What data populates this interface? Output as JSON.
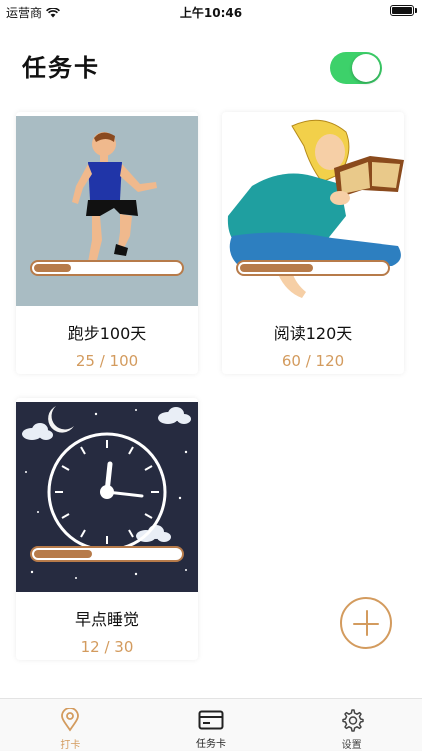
{
  "status_bar": {
    "carrier": "运营商",
    "time": "上午10:46"
  },
  "header": {
    "title": "任务卡",
    "toggle_on": true
  },
  "cards": [
    {
      "name": "跑步100天",
      "count": "25 / 100",
      "progress": 0.25
    },
    {
      "name": "阅读120天",
      "count": "60 / 120",
      "progress": 0.5
    },
    {
      "name": "早点睡觉",
      "count": "12 / 30",
      "progress": 0.4
    }
  ],
  "tabbar": {
    "tabs": [
      {
        "label": "打卡",
        "icon": "location-pin-icon",
        "color": "#d39b5e"
      },
      {
        "label": "任务卡",
        "icon": "card-icon",
        "color": "#222222"
      },
      {
        "label": "设置",
        "icon": "gear-icon",
        "color": "#444444"
      }
    ]
  },
  "colors": {
    "accent": "#d39b5e",
    "progress": "#b77b4a",
    "toggle": "#3dd16a"
  }
}
